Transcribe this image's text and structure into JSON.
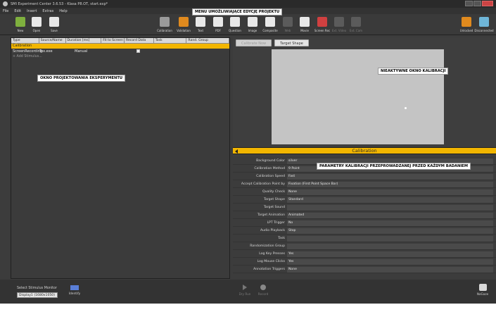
{
  "window": {
    "title": "SMI Experiment Center 3.6.53 - Klasa P8.OT, start.exp*"
  },
  "menu": [
    "File",
    "Edit",
    "Insert",
    "Extras",
    "Help"
  ],
  "toolbar": {
    "buttons": [
      {
        "label": "New",
        "icon": "new-file-icon",
        "color": "#7fb03e",
        "enabled": true
      },
      {
        "label": "Open",
        "icon": "open-folder-icon",
        "color": "#e8e8e8",
        "enabled": true
      },
      {
        "label": "Save",
        "icon": "save-icon",
        "color": "#e8e8e8",
        "enabled": true
      },
      {
        "label": "Calibration",
        "icon": "calibration-icon",
        "color": "#9a9a9a",
        "enabled": true
      },
      {
        "label": "Validation",
        "icon": "validation-icon",
        "color": "#e08a1e",
        "enabled": true
      },
      {
        "label": "Text",
        "icon": "text-icon",
        "color": "#e8e8e8",
        "enabled": true
      },
      {
        "label": "PDF",
        "icon": "pdf-icon",
        "color": "#e8e8e8",
        "enabled": true
      },
      {
        "label": "Question",
        "icon": "question-icon",
        "color": "#e8e8e8",
        "enabled": true
      },
      {
        "label": "Image",
        "icon": "image-icon",
        "color": "#e8e8e8",
        "enabled": true
      },
      {
        "label": "Composite",
        "icon": "composite-icon",
        "color": "#e8e8e8",
        "enabled": true
      },
      {
        "label": "Web",
        "icon": "web-icon",
        "color": "#9a9a9a",
        "enabled": false
      },
      {
        "label": "Movie",
        "icon": "movie-icon",
        "color": "#e8e8e8",
        "enabled": true
      },
      {
        "label": "Screen Rec",
        "icon": "screen-rec-icon",
        "color": "#d04040",
        "enabled": true
      },
      {
        "label": "Ext. Video",
        "icon": "ext-video-icon",
        "color": "#9a9a9a",
        "enabled": false
      },
      {
        "label": "Ext. Cam",
        "icon": "ext-cam-icon",
        "color": "#9a9a9a",
        "enabled": false
      },
      {
        "label": "Unlocked",
        "icon": "unlock-icon",
        "color": "#e08a1e",
        "enabled": true
      },
      {
        "label": "Disconnected",
        "icon": "disconnected-icon",
        "color": "#6fb6d8",
        "enabled": true
      }
    ]
  },
  "annotations": {
    "menu": "MENU UMOŻLIWIAJĄCE EDYCJĘ PROJEKTU",
    "design": "OKNO PROJEKTOWANIA EKSPERYMENTU",
    "calib_window": "NIEAKTYWNE OKNO KALIBRACJI",
    "params": "PARAMETRY KALIBRACJI PRZEPROWADZANEJ PRZED KAŻDYM BADANIEM"
  },
  "experiment_table": {
    "columns": [
      "Type",
      "Source/Name",
      "Duration [ms]",
      "Fit to Screen",
      "Record Data",
      "Task",
      "Rand. Group"
    ],
    "calibration_row": "Calibration",
    "rows": [
      {
        "type": "ScreenRecording",
        "source": "Tox.exe",
        "duration": "Manual",
        "record_data": true
      }
    ],
    "add_label": "+ Add Stimulus..."
  },
  "calibration_view": {
    "buttons": [
      "Calibrate Now",
      "Target Shape"
    ],
    "bar_label": "Calibration"
  },
  "properties": [
    {
      "label": "Background Color",
      "value": "silver"
    },
    {
      "label": "Calibration Method",
      "value": "9 Point"
    },
    {
      "label": "Calibration Speed",
      "value": "Fast"
    },
    {
      "label": "Accept Calibration Point by",
      "value": "Fixation (First Point Space Bar)"
    },
    {
      "label": "Quality Check",
      "value": "None"
    },
    {
      "label": "Target Shape",
      "value": "Standard"
    },
    {
      "label": "Target Sound",
      "value": ""
    },
    {
      "label": "Target Animation",
      "value": "Animated"
    },
    {
      "label": "LPT Trigger",
      "value": "No"
    },
    {
      "label": "Audio Playback",
      "value": "Stop"
    },
    {
      "label": "Task",
      "value": ""
    },
    {
      "label": "Randomization Group",
      "value": ""
    },
    {
      "label": "Log Key Presses",
      "value": "Yes"
    },
    {
      "label": "Log Mouse Clicks",
      "value": "Yes"
    },
    {
      "label": "Annotation Triggers",
      "value": "None"
    }
  ],
  "bottombar": {
    "monitor_label": "Select Stimulus Monitor",
    "monitor_value": "Display1 (1680x1050)",
    "identify_label": "Identify",
    "dry_run_label": "Dry Run",
    "record_label": "Record",
    "gaze_label": "NoGaze"
  }
}
